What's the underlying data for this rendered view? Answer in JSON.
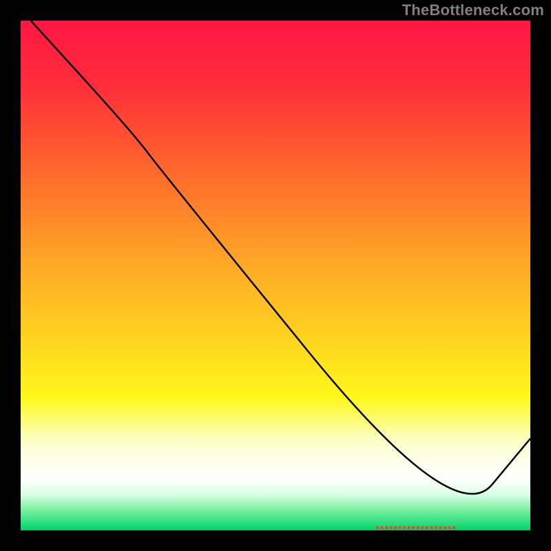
{
  "watermark": "TheBottleneck.com",
  "chart_data": {
    "type": "line",
    "title": "",
    "xlabel": "",
    "ylabel": "",
    "xlim": [
      0,
      100
    ],
    "ylim": [
      0,
      100
    ],
    "grid": false,
    "series": [
      {
        "name": "curve",
        "color": "#000000",
        "points": [
          {
            "x": 2,
            "y": 100
          },
          {
            "x": 22,
            "y": 78
          },
          {
            "x": 28,
            "y": 70
          },
          {
            "x": 85,
            "y": 0
          },
          {
            "x": 100,
            "y": 18
          }
        ]
      }
    ],
    "marker": {
      "color": "#ff3c1f",
      "x_range": [
        70,
        85
      ],
      "y": 0.5
    },
    "gradient_stops": [
      {
        "offset": 0.0,
        "color": "#ff1744"
      },
      {
        "offset": 0.12,
        "color": "#ff2b3a"
      },
      {
        "offset": 0.3,
        "color": "#ff6a2c"
      },
      {
        "offset": 0.48,
        "color": "#ffa927"
      },
      {
        "offset": 0.62,
        "color": "#ffd21f"
      },
      {
        "offset": 0.74,
        "color": "#fff81a"
      },
      {
        "offset": 0.82,
        "color": "#fbffc0"
      },
      {
        "offset": 0.86,
        "color": "#fdffe8"
      },
      {
        "offset": 0.9,
        "color": "#ffffff"
      },
      {
        "offset": 0.93,
        "color": "#d8ffe4"
      },
      {
        "offset": 0.96,
        "color": "#79f0a0"
      },
      {
        "offset": 1.0,
        "color": "#00d36b"
      }
    ]
  }
}
